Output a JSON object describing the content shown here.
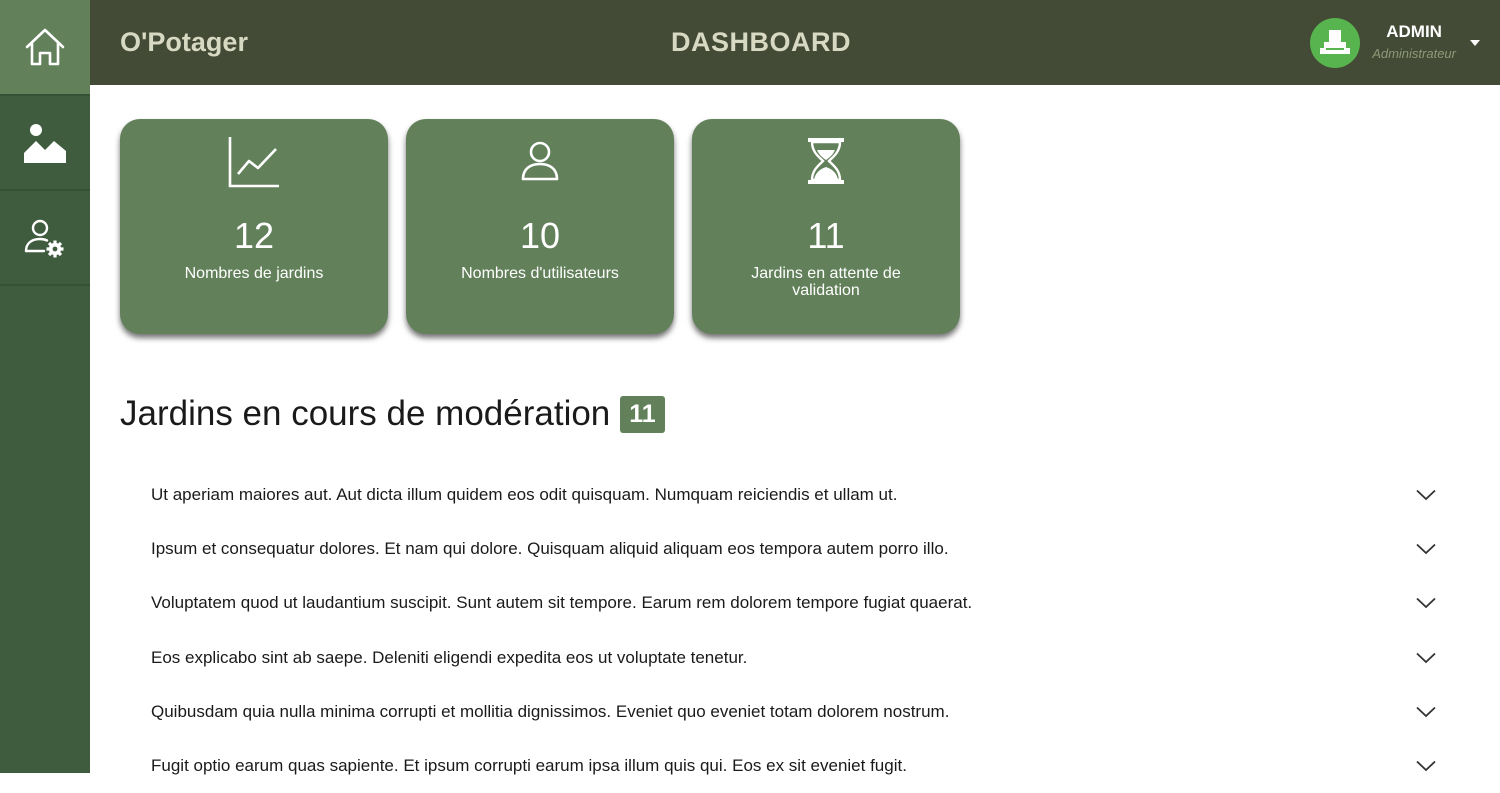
{
  "header": {
    "brand": "O'Potager",
    "title": "DASHBOARD",
    "user": {
      "name": "ADMIN",
      "role": "Administrateur"
    }
  },
  "sidebar": {
    "items": [
      {
        "icon": "home-icon"
      },
      {
        "icon": "image-icon"
      },
      {
        "icon": "user-settings-icon"
      }
    ]
  },
  "stats": [
    {
      "icon": "chart-line-icon",
      "value": "12",
      "label": "Nombres de jardins"
    },
    {
      "icon": "user-icon",
      "value": "10",
      "label": "Nombres d'utilisateurs"
    },
    {
      "icon": "hourglass-icon",
      "value": "11",
      "label": "Jardins en attente de validation"
    }
  ],
  "moderation": {
    "title": "Jardins en cours de modération",
    "count": "11",
    "items": [
      "Ut aperiam maiores aut. Aut dicta illum quidem eos odit quisquam. Numquam reiciendis et ullam ut.",
      "Ipsum et consequatur dolores. Et nam qui dolore. Quisquam aliquid aliquam eos tempora autem porro illo.",
      "Voluptatem quod ut laudantium suscipit. Sunt autem sit tempore. Earum rem dolorem tempore fugiat quaerat.",
      "Eos explicabo sint ab saepe. Deleniti eligendi expedita eos ut voluptate tenetur.",
      "Quibusdam quia nulla minima corrupti et mollitia dignissimos. Eveniet quo eveniet totam dolorem nostrum.",
      "Fugit optio earum quas sapiente. Et ipsum corrupti earum ipsa illum quis qui. Eos ex sit eveniet fugit."
    ]
  },
  "colors": {
    "sidebar": "#3f5c3f",
    "header": "#434a35",
    "accent": "#62805a",
    "avatar": "#58b44e"
  }
}
